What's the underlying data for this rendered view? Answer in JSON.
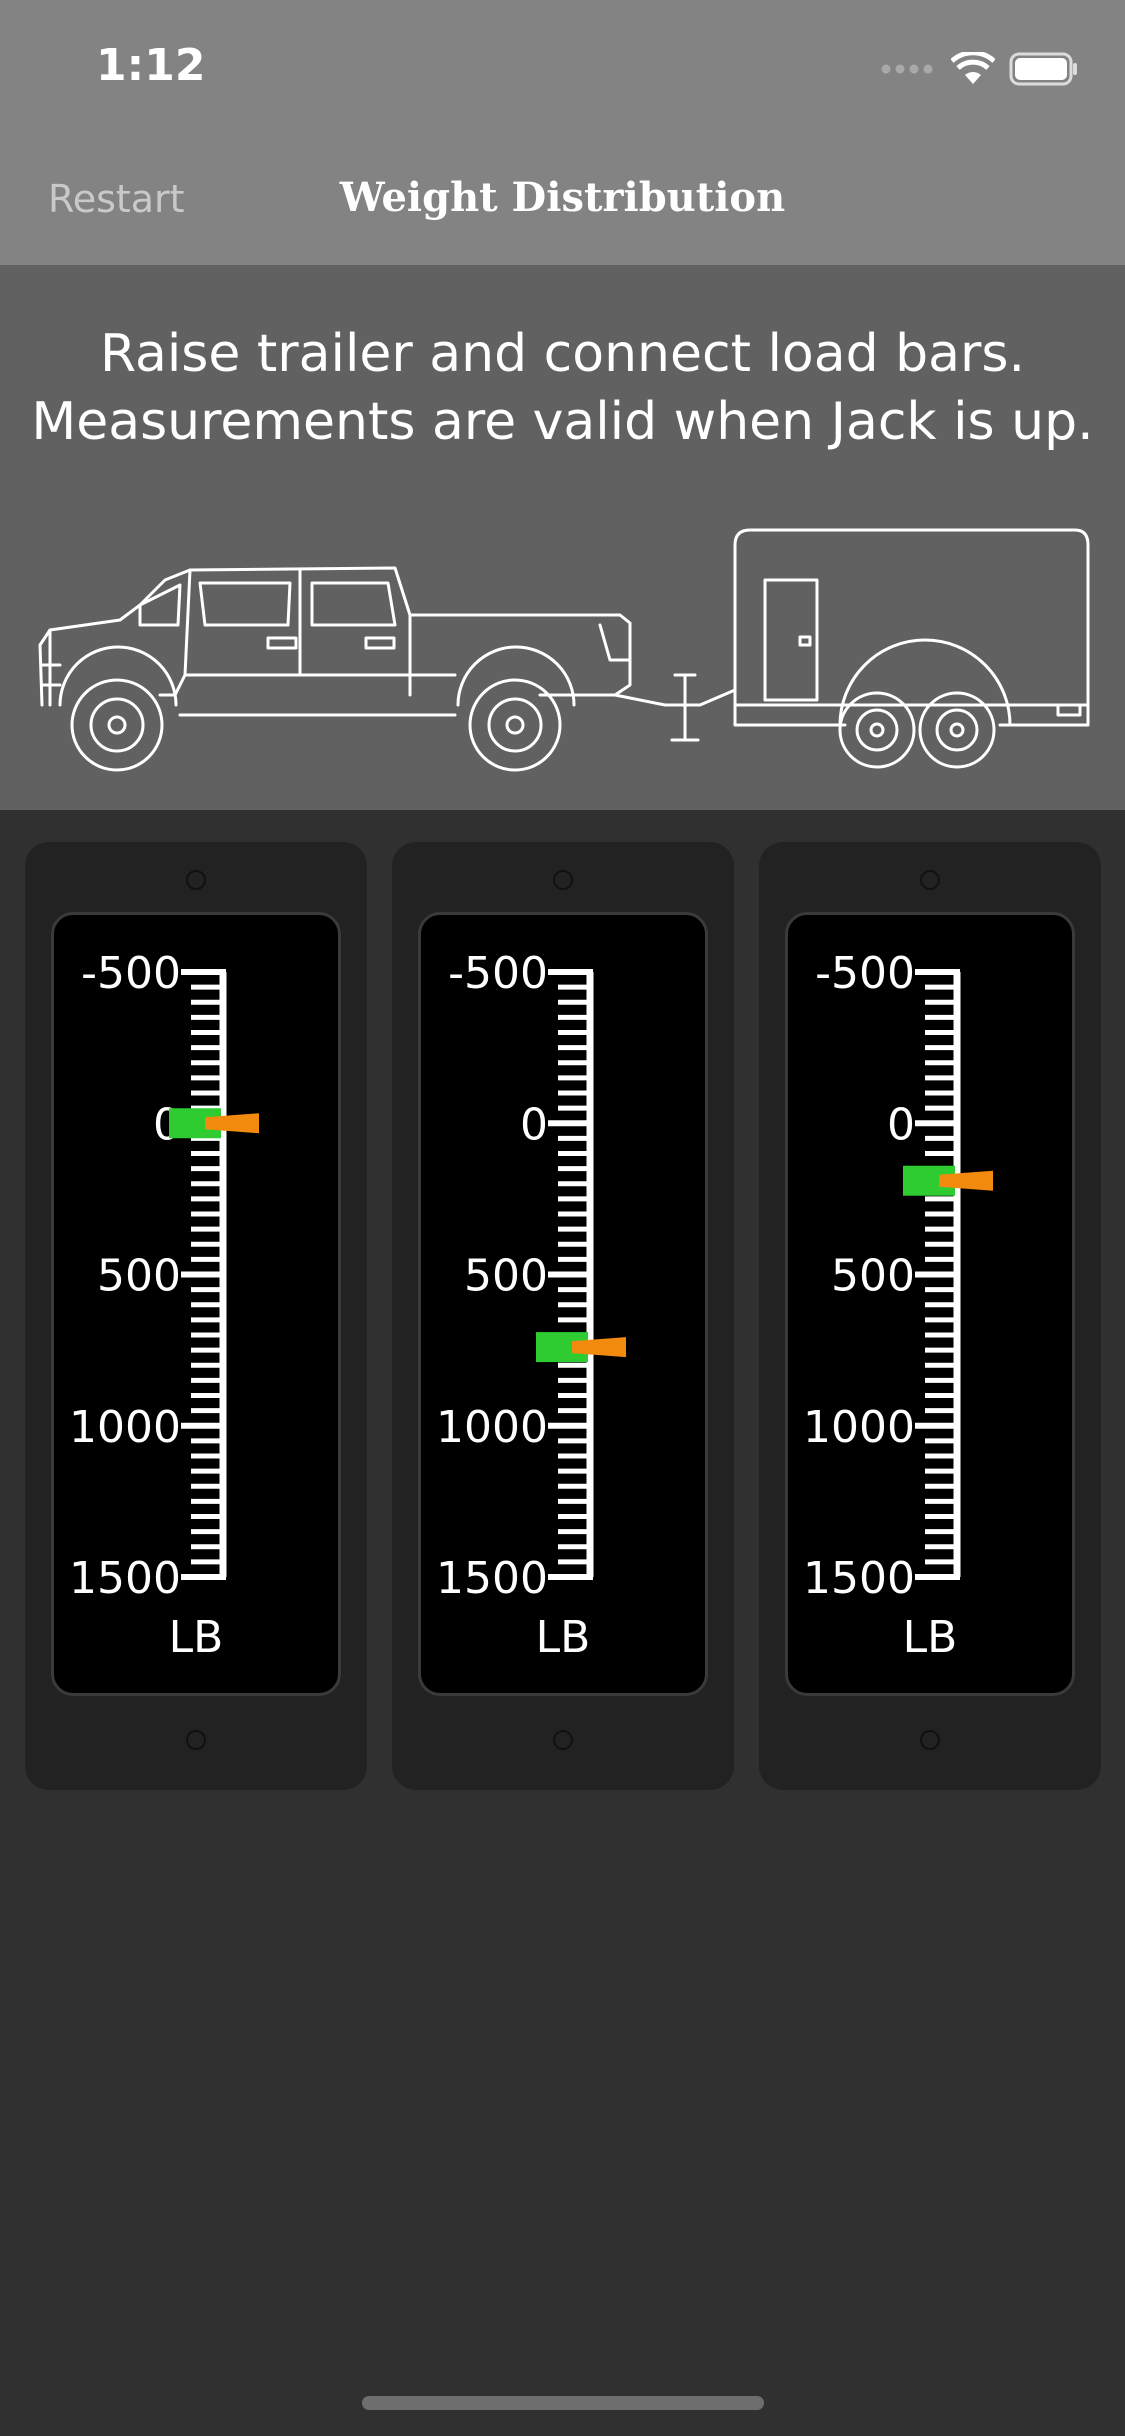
{
  "status_bar": {
    "time": "1:12"
  },
  "nav": {
    "restart_label": "Restart",
    "title": "Weight Distribution"
  },
  "banner": {
    "line1": "Raise trailer and connect load bars.",
    "line2": "Measurements are valid when Jack is up."
  },
  "gauge_scale": {
    "min": -500,
    "max": 1500,
    "labels": [
      "-500",
      "0",
      "500",
      "1000",
      "1500"
    ],
    "unit": "LB"
  },
  "gauges": [
    {
      "value": 0
    },
    {
      "value": 740
    },
    {
      "value": 190
    }
  ],
  "colors": {
    "header": "#838383",
    "banner": "#626161",
    "background": "#303030",
    "panel": "#222222",
    "indicator_green": "#2ecc31",
    "indicator_orange": "#f28a0d"
  }
}
